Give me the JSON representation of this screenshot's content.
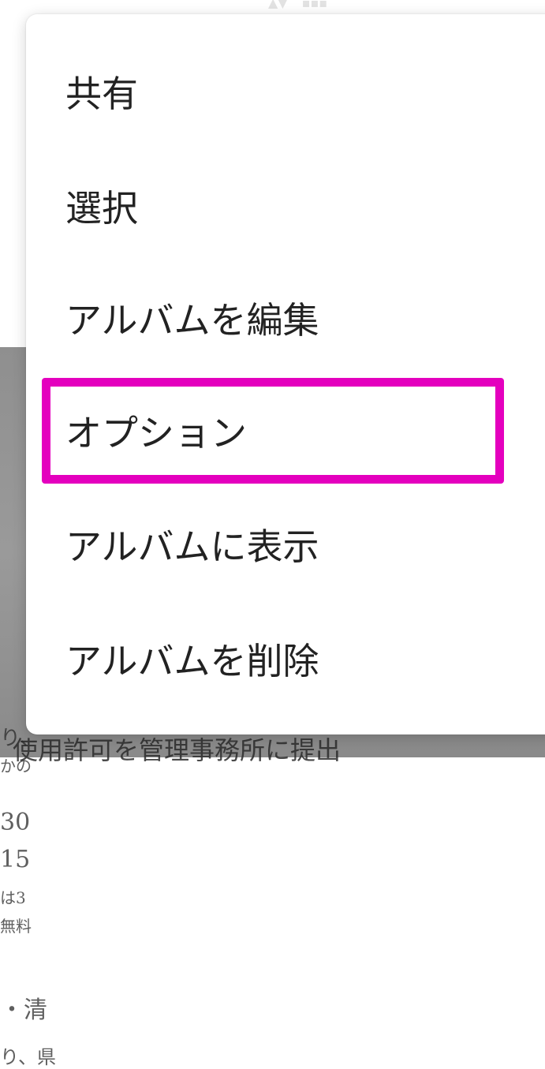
{
  "background": {
    "photo_fragments": [
      "り、",
      "かの",
      "30",
      "15",
      "は3",
      "無料",
      "・清",
      "り、県"
    ],
    "photo_caption": "使用許可を管理事務所に提出"
  },
  "top_indicator": {
    "left_icon": "sort-arrows-icon",
    "right_icon": "more-dots-icon"
  },
  "menu": {
    "items": [
      {
        "label": "共有"
      },
      {
        "label": "選択"
      },
      {
        "label": "アルバムを編集"
      },
      {
        "label": "オプション"
      },
      {
        "label": "アルバムに表示"
      },
      {
        "label": "アルバムを削除"
      }
    ]
  },
  "highlight": {
    "color": "#e400be",
    "target": "オプション"
  }
}
